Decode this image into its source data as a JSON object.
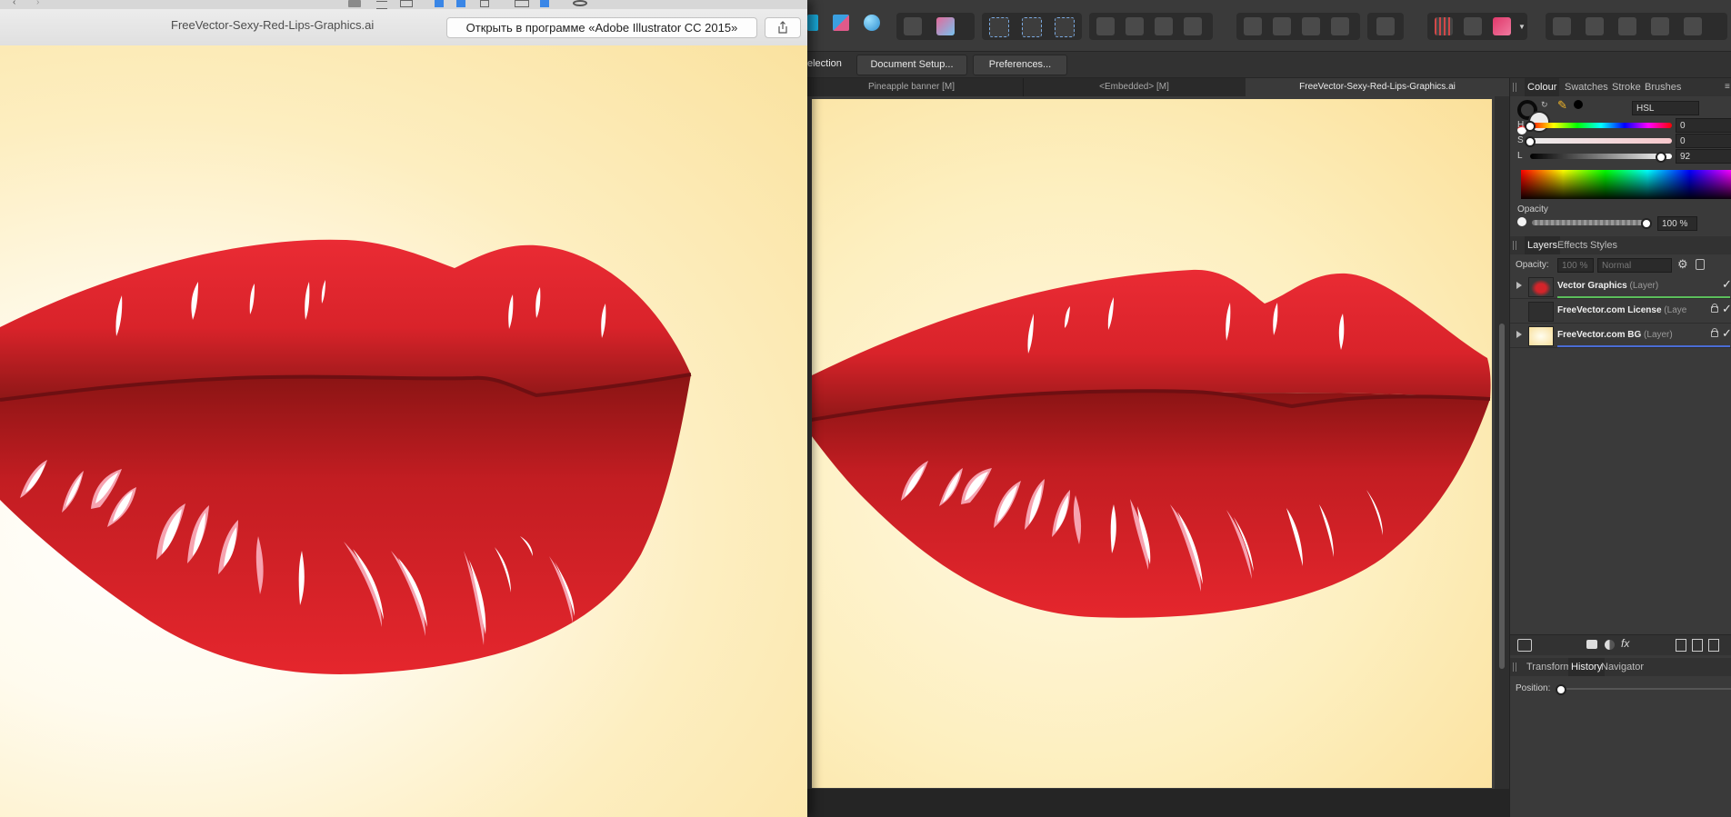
{
  "quicklook": {
    "title": "FreeVector-Sexy-Red-Lips-Graphics.ai",
    "open_button": "Открыть в программе «Adobe Illustrator CC 2015»",
    "share_icon": "share-icon"
  },
  "context_toolbar": {
    "selection_label": "election",
    "document_setup": "Document Setup...",
    "preferences": "Preferences..."
  },
  "document_tabs": [
    {
      "label": "Pineapple banner [M]",
      "active": false
    },
    {
      "label": "<Embedded> [M]",
      "active": false
    },
    {
      "label": "FreeVector-Sexy-Red-Lips-Graphics.ai",
      "active": true
    }
  ],
  "colour_panel": {
    "tabs": [
      "Colour",
      "Swatches",
      "Stroke",
      "Brushes"
    ],
    "active_tab": "Colour",
    "mode": "HSL",
    "sliders": [
      {
        "label": "H",
        "value": "0",
        "position": 0.0
      },
      {
        "label": "S",
        "value": "0",
        "position": 0.0
      },
      {
        "label": "L",
        "value": "92",
        "position": 0.92
      }
    ],
    "opacity_label": "Opacity",
    "opacity_value": "100 %"
  },
  "layers_panel": {
    "tabs": [
      "Layers",
      "Effects",
      "Styles"
    ],
    "active_tab": "Layers",
    "opacity_label": "Opacity:",
    "opacity_value": "100 %",
    "blend_mode": "Normal",
    "layers": [
      {
        "name": "Vector Graphics",
        "type": "(Layer)",
        "expandable": true,
        "locked": false,
        "visible": true,
        "accent": "#5bbf5b"
      },
      {
        "name": "FreeVector.com License",
        "type": "(Laye",
        "expandable": false,
        "locked": true,
        "visible": true,
        "accent": "#2d2d2d"
      },
      {
        "name": "FreeVector.com BG",
        "type": "(Layer)",
        "expandable": true,
        "locked": true,
        "visible": true,
        "accent": "#4a6cd4"
      }
    ]
  },
  "bottom_panel": {
    "tabs": [
      "Transform",
      "History",
      "Navigator"
    ],
    "active_tab": "History",
    "position_label": "Position:"
  },
  "colors": {
    "lip_red": "#e8262e",
    "lip_dark": "#8a1414",
    "highlight": "#ffffff",
    "highlight_pink": "#f6a3b0"
  }
}
